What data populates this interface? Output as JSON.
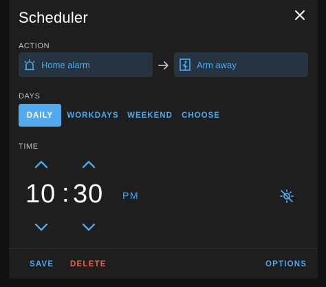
{
  "dialog": {
    "title": "Scheduler",
    "close_icon": "close-icon"
  },
  "action": {
    "label": "ACTION",
    "entity": {
      "label": "Home alarm",
      "icon": "alarm-light-icon"
    },
    "arrow_icon": "arrow-right-icon",
    "service": {
      "label": "Arm away",
      "icon": "walk-out-door-icon"
    }
  },
  "days": {
    "label": "DAYS",
    "options": [
      "DAILY",
      "WORKDAYS",
      "WEEKEND",
      "CHOOSE"
    ],
    "selected": "DAILY"
  },
  "time": {
    "label": "TIME",
    "hours": "10",
    "separator": ":",
    "minutes": "30",
    "period": "PM",
    "sun_toggle_icon": "sun-off-icon"
  },
  "footer": {
    "save": "SAVE",
    "delete": "DELETE",
    "options": "OPTIONS"
  },
  "colors": {
    "accent": "#4ea8f0",
    "active_button": "#52aaee",
    "chip_bg": "#263340",
    "delete": "#e8644f",
    "dialog_bg": "#1e1e1e"
  }
}
